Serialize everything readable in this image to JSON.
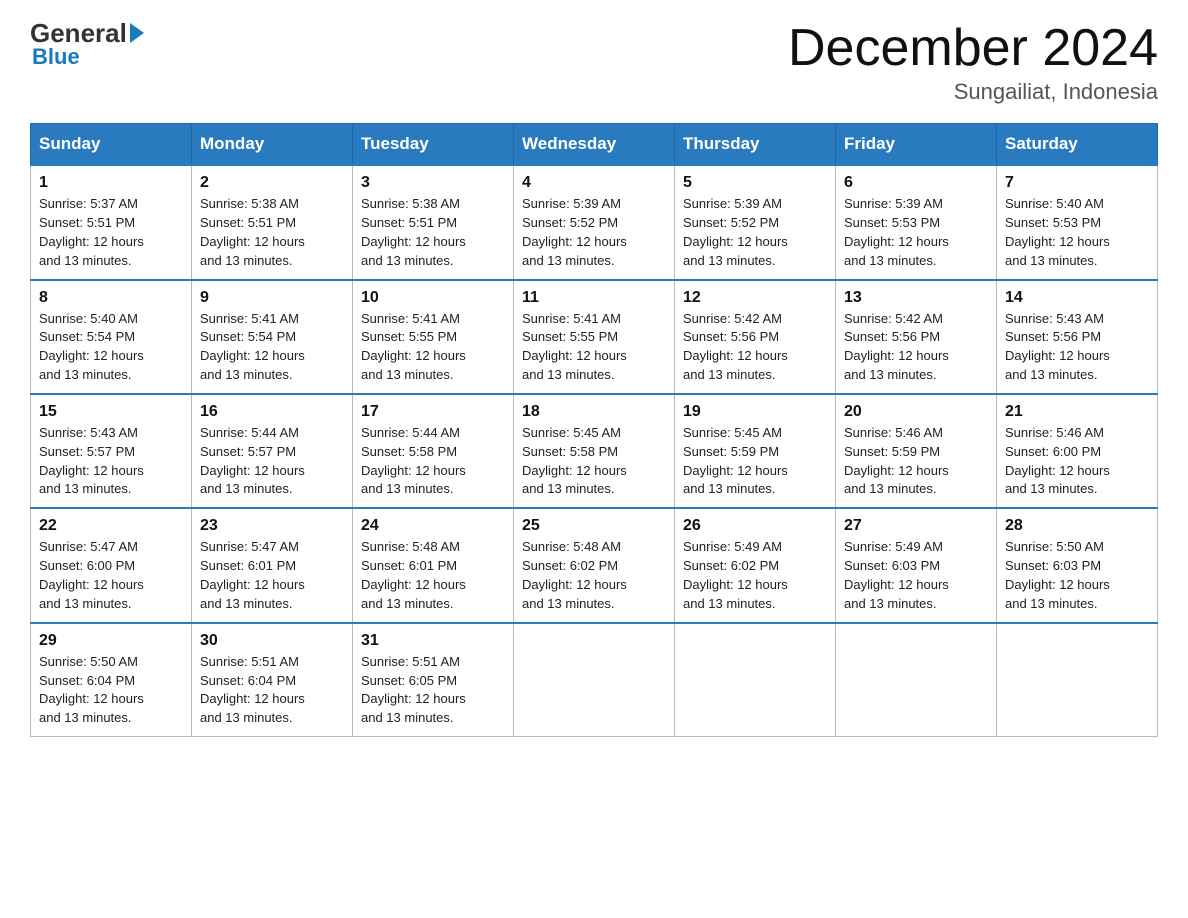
{
  "header": {
    "logo": {
      "general": "General",
      "blue": "Blue"
    },
    "title": "December 2024",
    "location": "Sungailiat, Indonesia"
  },
  "weekdays": [
    "Sunday",
    "Monday",
    "Tuesday",
    "Wednesday",
    "Thursday",
    "Friday",
    "Saturday"
  ],
  "weeks": [
    [
      {
        "day": "1",
        "sunrise": "5:37 AM",
        "sunset": "5:51 PM",
        "daylight": "12 hours and 13 minutes."
      },
      {
        "day": "2",
        "sunrise": "5:38 AM",
        "sunset": "5:51 PM",
        "daylight": "12 hours and 13 minutes."
      },
      {
        "day": "3",
        "sunrise": "5:38 AM",
        "sunset": "5:51 PM",
        "daylight": "12 hours and 13 minutes."
      },
      {
        "day": "4",
        "sunrise": "5:39 AM",
        "sunset": "5:52 PM",
        "daylight": "12 hours and 13 minutes."
      },
      {
        "day": "5",
        "sunrise": "5:39 AM",
        "sunset": "5:52 PM",
        "daylight": "12 hours and 13 minutes."
      },
      {
        "day": "6",
        "sunrise": "5:39 AM",
        "sunset": "5:53 PM",
        "daylight": "12 hours and 13 minutes."
      },
      {
        "day": "7",
        "sunrise": "5:40 AM",
        "sunset": "5:53 PM",
        "daylight": "12 hours and 13 minutes."
      }
    ],
    [
      {
        "day": "8",
        "sunrise": "5:40 AM",
        "sunset": "5:54 PM",
        "daylight": "12 hours and 13 minutes."
      },
      {
        "day": "9",
        "sunrise": "5:41 AM",
        "sunset": "5:54 PM",
        "daylight": "12 hours and 13 minutes."
      },
      {
        "day": "10",
        "sunrise": "5:41 AM",
        "sunset": "5:55 PM",
        "daylight": "12 hours and 13 minutes."
      },
      {
        "day": "11",
        "sunrise": "5:41 AM",
        "sunset": "5:55 PM",
        "daylight": "12 hours and 13 minutes."
      },
      {
        "day": "12",
        "sunrise": "5:42 AM",
        "sunset": "5:56 PM",
        "daylight": "12 hours and 13 minutes."
      },
      {
        "day": "13",
        "sunrise": "5:42 AM",
        "sunset": "5:56 PM",
        "daylight": "12 hours and 13 minutes."
      },
      {
        "day": "14",
        "sunrise": "5:43 AM",
        "sunset": "5:56 PM",
        "daylight": "12 hours and 13 minutes."
      }
    ],
    [
      {
        "day": "15",
        "sunrise": "5:43 AM",
        "sunset": "5:57 PM",
        "daylight": "12 hours and 13 minutes."
      },
      {
        "day": "16",
        "sunrise": "5:44 AM",
        "sunset": "5:57 PM",
        "daylight": "12 hours and 13 minutes."
      },
      {
        "day": "17",
        "sunrise": "5:44 AM",
        "sunset": "5:58 PM",
        "daylight": "12 hours and 13 minutes."
      },
      {
        "day": "18",
        "sunrise": "5:45 AM",
        "sunset": "5:58 PM",
        "daylight": "12 hours and 13 minutes."
      },
      {
        "day": "19",
        "sunrise": "5:45 AM",
        "sunset": "5:59 PM",
        "daylight": "12 hours and 13 minutes."
      },
      {
        "day": "20",
        "sunrise": "5:46 AM",
        "sunset": "5:59 PM",
        "daylight": "12 hours and 13 minutes."
      },
      {
        "day": "21",
        "sunrise": "5:46 AM",
        "sunset": "6:00 PM",
        "daylight": "12 hours and 13 minutes."
      }
    ],
    [
      {
        "day": "22",
        "sunrise": "5:47 AM",
        "sunset": "6:00 PM",
        "daylight": "12 hours and 13 minutes."
      },
      {
        "day": "23",
        "sunrise": "5:47 AM",
        "sunset": "6:01 PM",
        "daylight": "12 hours and 13 minutes."
      },
      {
        "day": "24",
        "sunrise": "5:48 AM",
        "sunset": "6:01 PM",
        "daylight": "12 hours and 13 minutes."
      },
      {
        "day": "25",
        "sunrise": "5:48 AM",
        "sunset": "6:02 PM",
        "daylight": "12 hours and 13 minutes."
      },
      {
        "day": "26",
        "sunrise": "5:49 AM",
        "sunset": "6:02 PM",
        "daylight": "12 hours and 13 minutes."
      },
      {
        "day": "27",
        "sunrise": "5:49 AM",
        "sunset": "6:03 PM",
        "daylight": "12 hours and 13 minutes."
      },
      {
        "day": "28",
        "sunrise": "5:50 AM",
        "sunset": "6:03 PM",
        "daylight": "12 hours and 13 minutes."
      }
    ],
    [
      {
        "day": "29",
        "sunrise": "5:50 AM",
        "sunset": "6:04 PM",
        "daylight": "12 hours and 13 minutes."
      },
      {
        "day": "30",
        "sunrise": "5:51 AM",
        "sunset": "6:04 PM",
        "daylight": "12 hours and 13 minutes."
      },
      {
        "day": "31",
        "sunrise": "5:51 AM",
        "sunset": "6:05 PM",
        "daylight": "12 hours and 13 minutes."
      },
      null,
      null,
      null,
      null
    ]
  ]
}
